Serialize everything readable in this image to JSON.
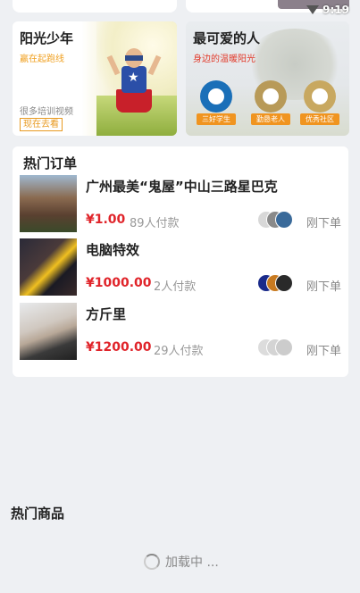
{
  "status_bar": {
    "time": "9:19",
    "wifi_icon": "wifi-icon"
  },
  "banners": [
    {
      "title": "阳光少年",
      "subtitle": "赢在起跑线",
      "description": "很多培训视频",
      "cta": "现在去看"
    },
    {
      "title": "最可爱的人",
      "subtitle": "身边的温暖阳光",
      "badges": [
        "三好学生",
        "勤恳老人",
        "优秀社区"
      ]
    }
  ],
  "hot_orders": {
    "title": "热门订单",
    "items": [
      {
        "name": "广州最美“鬼屋”中山三路星巴克",
        "price": "¥1.00",
        "payers": "89人付款",
        "status": "刚下单"
      },
      {
        "name": "电脑特效",
        "price": "¥1000.00",
        "payers": "2人付款",
        "status": "刚下单"
      },
      {
        "name": "方斤里",
        "price": "¥1200.00",
        "payers": "29人付款",
        "status": "刚下单"
      }
    ]
  },
  "hot_goods": {
    "title": "热门商品",
    "loading": "加载中 ..."
  },
  "colors": {
    "price": "#e0242a",
    "accent": "#f09420",
    "background": "#eef0f3"
  }
}
